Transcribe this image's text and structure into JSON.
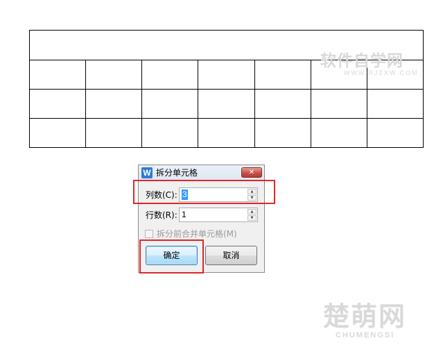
{
  "watermarks": {
    "top_cn": "软件自学网",
    "top_url": "WWW.RJZXW.COM",
    "bottom_cn": "楚萌网",
    "bottom_en": "CHUMENGSI"
  },
  "document_table": {
    "merged_rows": 1,
    "rows": 3,
    "columns": 7
  },
  "dialog": {
    "icon_letter": "W",
    "title": "拆分单元格",
    "close_symbol": "✕",
    "columns_label": "列数(C):",
    "columns_value": "3",
    "rows_label": "行数(R):",
    "rows_value": "1",
    "spin_up": "▲",
    "spin_down": "▼",
    "merge_before_split_label": "拆分前合并单元格(M)",
    "merge_before_split_checked": false,
    "ok_label": "确定",
    "cancel_label": "取消"
  },
  "colors": {
    "highlight": "#e0262a",
    "dialog_bg": "#f0f0f0",
    "selection": "#3399ff",
    "app_icon": "#2f7bd5"
  }
}
